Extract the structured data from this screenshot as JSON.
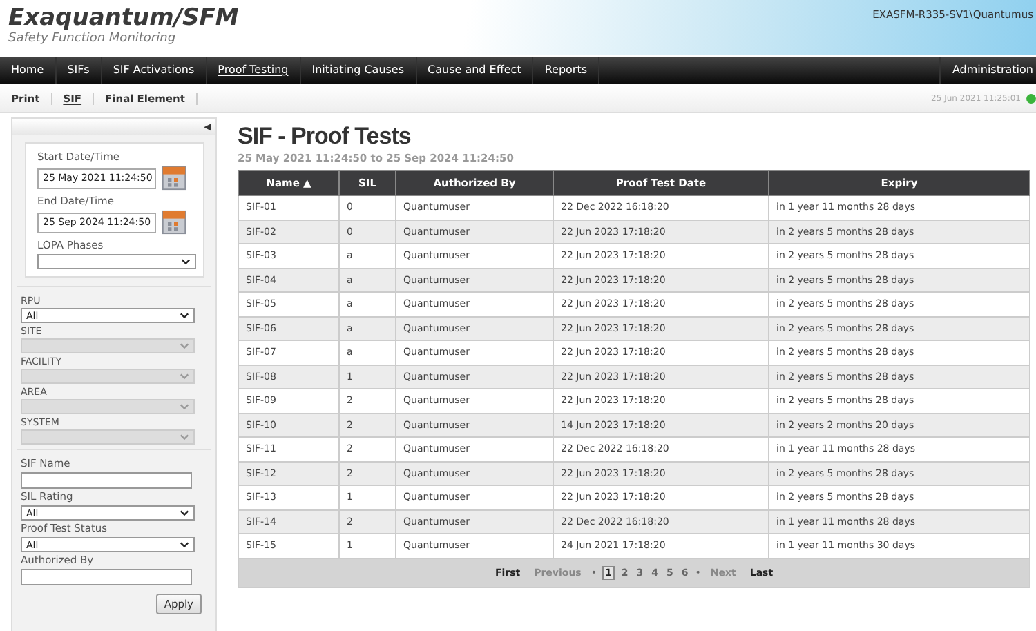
{
  "header": {
    "logo": "Exaquantum/SFM",
    "subtitle": "Safety Function Monitoring",
    "user": "EXASFM-R335-SV1\\Quantumus"
  },
  "nav": {
    "items": [
      {
        "label": "Home",
        "selected": false
      },
      {
        "label": "SIFs",
        "selected": false
      },
      {
        "label": "SIF Activations",
        "selected": false
      },
      {
        "label": "Proof Testing",
        "selected": true
      },
      {
        "label": "Initiating Causes",
        "selected": false
      },
      {
        "label": "Cause and Effect",
        "selected": false
      },
      {
        "label": "Reports",
        "selected": false
      }
    ],
    "right": "Administration"
  },
  "subnav": {
    "items": [
      {
        "label": "Print",
        "selected": false
      },
      {
        "label": "SIF",
        "selected": true
      },
      {
        "label": "Final Element",
        "selected": false
      }
    ],
    "timestamp": "25 Jun 2021 11:25:01",
    "connected": true
  },
  "sidebar": {
    "collapse_icon": "◀",
    "dates": [
      {
        "label": "Start Date/Time",
        "value": "25 May 2021 11:24:50"
      },
      {
        "label": "End Date/Time",
        "value": "25 Sep 2024 11:24:50"
      }
    ],
    "lopa": {
      "label": "LOPA Phases"
    },
    "hierarchy": [
      {
        "label": "RPU",
        "value": "All",
        "disabled": false
      },
      {
        "label": "SITE",
        "disabled": true
      },
      {
        "label": "FACILITY",
        "disabled": true
      },
      {
        "label": "AREA",
        "disabled": true
      },
      {
        "label": "SYSTEM",
        "disabled": true
      }
    ],
    "filters": [
      {
        "label": "SIF Name",
        "kind": "text"
      },
      {
        "label": "SIL Rating",
        "kind": "select",
        "value": "All"
      },
      {
        "label": "Proof Test Status",
        "kind": "select",
        "value": "All"
      },
      {
        "label": "Authorized By",
        "kind": "text"
      }
    ],
    "apply": "Apply"
  },
  "main": {
    "title": "SIF - Proof Tests",
    "range": "25 May 2021 11:24:50 to 25 Sep 2024 11:24:50",
    "table": {
      "columns": [
        "Name ▲",
        "SIL",
        "Authorized By",
        "Proof Test Date",
        "Expiry"
      ],
      "rows": [
        [
          "SIF-01",
          "0",
          "Quantumuser",
          "22 Dec 2022 16:18:20",
          "in 1 year 11 months 28 days"
        ],
        [
          "SIF-02",
          "0",
          "Quantumuser",
          "22 Jun 2023 17:18:20",
          "in 2 years 5 months 28 days"
        ],
        [
          "SIF-03",
          "a",
          "Quantumuser",
          "22 Jun 2023 17:18:20",
          "in 2 years 5 months 28 days"
        ],
        [
          "SIF-04",
          "a",
          "Quantumuser",
          "22 Jun 2023 17:18:20",
          "in 2 years 5 months 28 days"
        ],
        [
          "SIF-05",
          "a",
          "Quantumuser",
          "22 Jun 2023 17:18:20",
          "in 2 years 5 months 28 days"
        ],
        [
          "SIF-06",
          "a",
          "Quantumuser",
          "22 Jun 2023 17:18:20",
          "in 2 years 5 months 28 days"
        ],
        [
          "SIF-07",
          "a",
          "Quantumuser",
          "22 Jun 2023 17:18:20",
          "in 2 years 5 months 28 days"
        ],
        [
          "SIF-08",
          "1",
          "Quantumuser",
          "22 Jun 2023 17:18:20",
          "in 2 years 5 months 28 days"
        ],
        [
          "SIF-09",
          "2",
          "Quantumuser",
          "22 Jun 2023 17:18:20",
          "in 2 years 5 months 28 days"
        ],
        [
          "SIF-10",
          "2",
          "Quantumuser",
          "14 Jun 2023 17:18:20",
          "in 2 years 2 months 20 days"
        ],
        [
          "SIF-11",
          "2",
          "Quantumuser",
          "22 Dec 2022 16:18:20",
          "in 1 year 11 months 28 days"
        ],
        [
          "SIF-12",
          "2",
          "Quantumuser",
          "22 Jun 2023 17:18:20",
          "in 2 years 5 months 28 days"
        ],
        [
          "SIF-13",
          "1",
          "Quantumuser",
          "22 Jun 2023 17:18:20",
          "in 2 years 5 months 28 days"
        ],
        [
          "SIF-14",
          "2",
          "Quantumuser",
          "22 Dec 2022 16:18:20",
          "in 1 year 11 months 28 days"
        ],
        [
          "SIF-15",
          "1",
          "Quantumuser",
          "24 Jun 2021 17:18:20",
          "in 1 year 11 months 30 days"
        ]
      ]
    },
    "pager": {
      "first": "First",
      "previous": "Previous",
      "previous_disabled": true,
      "separator": "•",
      "pages": [
        {
          "label": "1",
          "selected": true
        },
        {
          "label": "2",
          "selected": false
        },
        {
          "label": "3",
          "selected": false
        },
        {
          "label": "4",
          "selected": false
        },
        {
          "label": "5",
          "selected": false
        },
        {
          "label": "6",
          "selected": false
        }
      ],
      "next": "Next",
      "last": "Last"
    }
  }
}
